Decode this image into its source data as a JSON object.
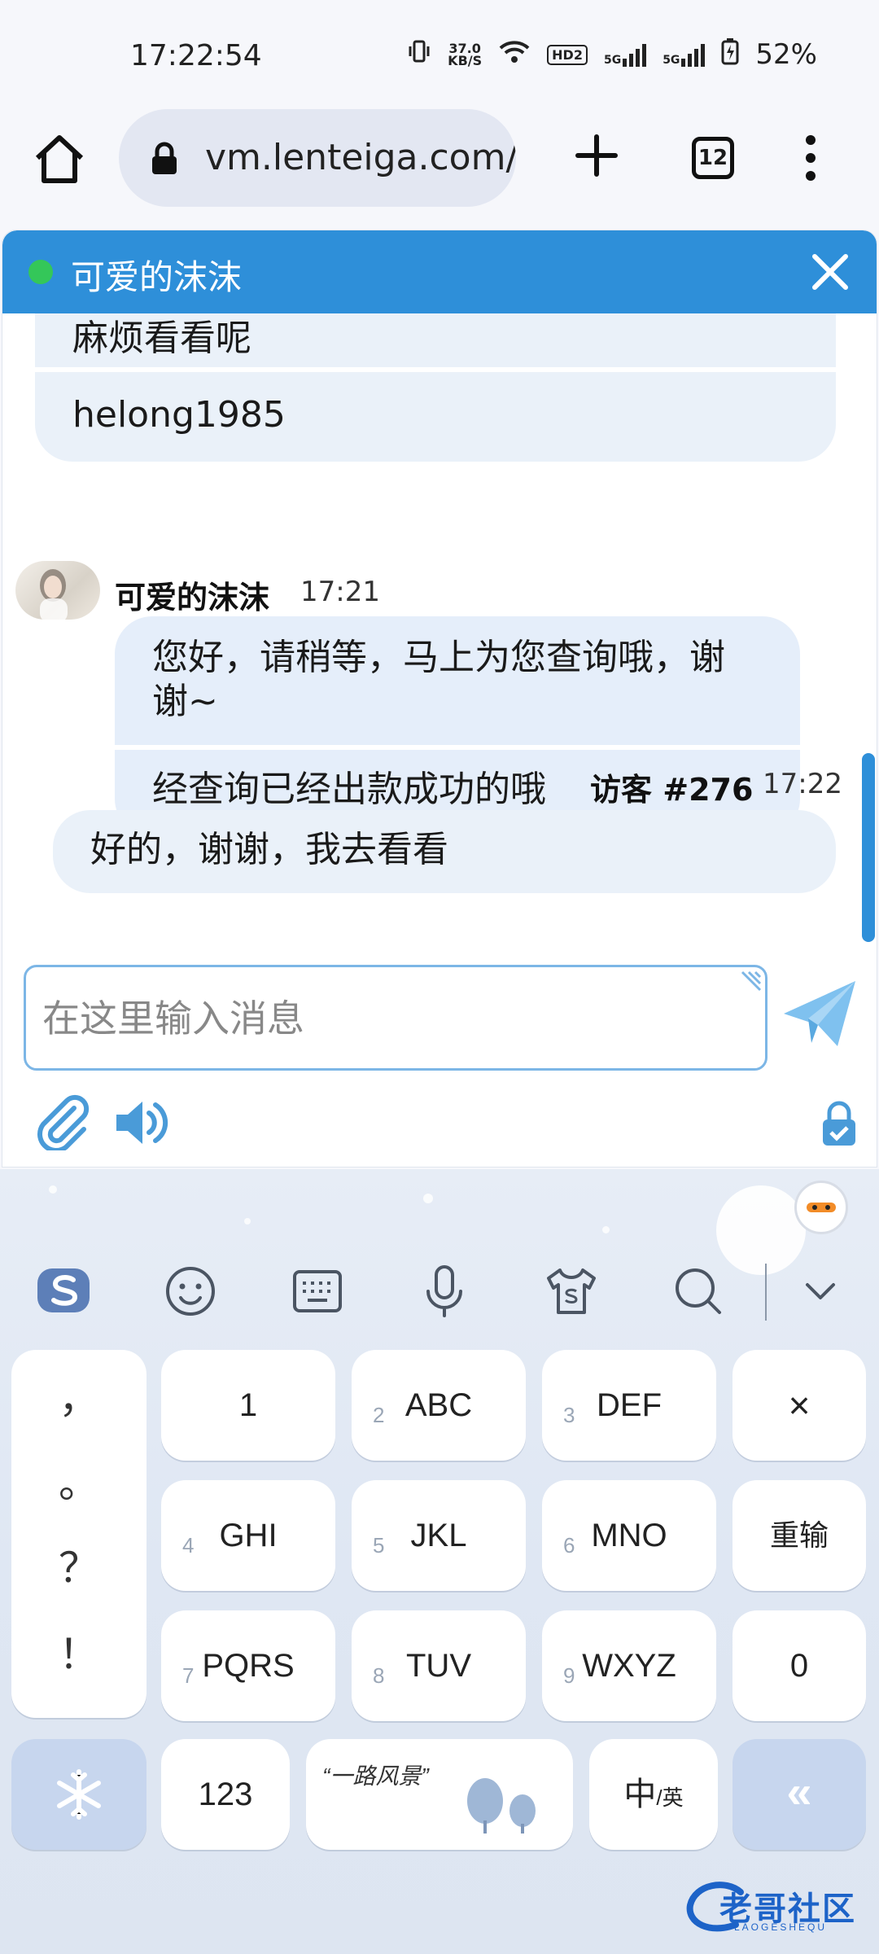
{
  "status_bar": {
    "time": "17:22:54",
    "net_speed_value": "37.0",
    "net_speed_unit": "KB/S",
    "hd_label": "HD2",
    "sim1_label": "5G",
    "sim2_label": "5G",
    "battery_percent": "52%"
  },
  "browser": {
    "url": "vm.lenteiga.com/",
    "tab_count": "12"
  },
  "chat": {
    "title": "可爱的沫沫",
    "messages_prev": [
      "麻烦看看呢",
      "helong1985"
    ],
    "agent": {
      "name": "可爱的沫沫",
      "time": "17:21",
      "messages": [
        "您好，请稍等，马上为您查询哦，谢谢~",
        "经查询已经出款成功的哦"
      ]
    },
    "visitor": {
      "name": "访客 #276",
      "time": "17:22",
      "message": "好的，谢谢，我去看看"
    },
    "input_placeholder": "在这里输入消息",
    "colors": {
      "header": "#2e8fd9",
      "bubble": "#e5eefa",
      "online": "#34c759"
    }
  },
  "keyboard": {
    "toolbar_icons": [
      "sogou-logo-icon",
      "emoji-icon",
      "keyboard-icon",
      "microphone-icon",
      "skin-shirt-icon",
      "search-icon",
      "collapse-icon"
    ],
    "punctuation": [
      "，",
      "。",
      "？",
      "！"
    ],
    "keys": [
      {
        "num": "",
        "label": "1"
      },
      {
        "num": "2",
        "label": "ABC"
      },
      {
        "num": "3",
        "label": "DEF"
      },
      {
        "num": "4",
        "label": "GHI"
      },
      {
        "num": "5",
        "label": "JKL"
      },
      {
        "num": "6",
        "label": "MNO"
      },
      {
        "num": "7",
        "label": "PQRS"
      },
      {
        "num": "8",
        "label": "TUV"
      },
      {
        "num": "9",
        "label": "WXYZ"
      }
    ],
    "delete_key": "×",
    "reinput_key": "重输",
    "zero_key": "0",
    "num_key": "123",
    "space_text": "“一路风景”",
    "lang_key_main": "中",
    "lang_key_sub": "/英",
    "enter_key": "«"
  },
  "watermark": {
    "text": "老哥社区",
    "sub": "LAOGESHEQU"
  }
}
